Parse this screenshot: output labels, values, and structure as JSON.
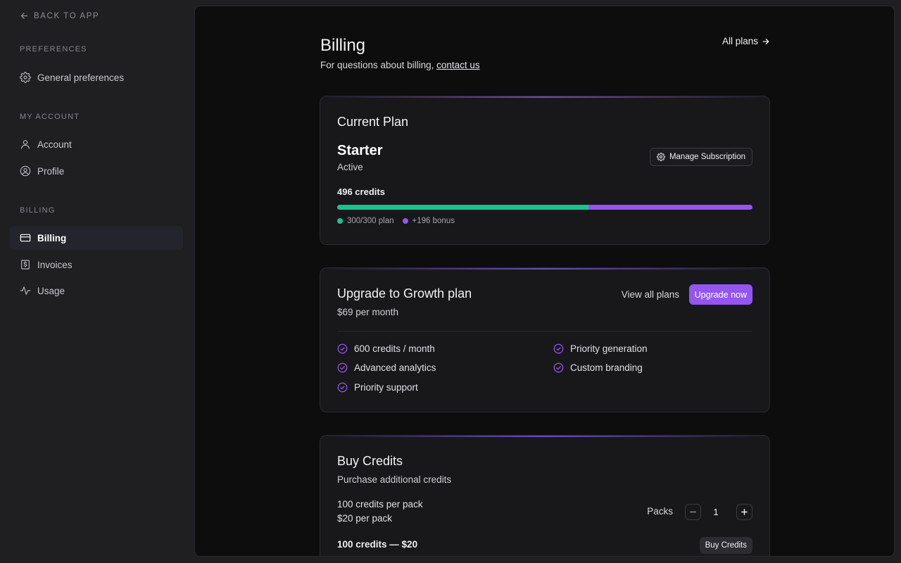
{
  "sidebar": {
    "back_label": "BACK TO APP",
    "sections": [
      {
        "label": "PREFERENCES",
        "items": [
          {
            "label": "General preferences",
            "icon": "gear-icon"
          }
        ]
      },
      {
        "label": "MY ACCOUNT",
        "items": [
          {
            "label": "Account",
            "icon": "user-icon"
          },
          {
            "label": "Profile",
            "icon": "user-circle-icon"
          }
        ]
      },
      {
        "label": "BILLING",
        "items": [
          {
            "label": "Billing",
            "icon": "credit-card-icon",
            "active": true
          },
          {
            "label": "Invoices",
            "icon": "dollar-receipt-icon"
          },
          {
            "label": "Usage",
            "icon": "activity-icon"
          }
        ]
      }
    ]
  },
  "header": {
    "title": "Billing",
    "subtitle_prefix": "For questions about billing, ",
    "contact_link": "contact us",
    "all_plans_label": "All plans"
  },
  "current_plan": {
    "title": "Current Plan",
    "plan_name": "Starter",
    "status": "Active",
    "manage_label": "Manage Subscription",
    "credits_label": "496 credits",
    "plan_credits_used": 300,
    "plan_credits_total": 300,
    "bonus_credits": 196,
    "legend_plan": "300/300 plan",
    "legend_bonus": "+196 bonus"
  },
  "upgrade": {
    "title": "Upgrade to Growth plan",
    "price": "$69 per month",
    "view_all_label": "View all plans",
    "upgrade_label": "Upgrade now",
    "features": [
      "600 credits / month",
      "Priority generation",
      "Advanced analytics",
      "Custom branding",
      "Priority support"
    ]
  },
  "buy_credits": {
    "title": "Buy Credits",
    "subtitle": "Purchase additional credits",
    "per_pack_credits": "100 credits per pack",
    "per_pack_price": "$20 per pack",
    "packs_label": "Packs",
    "packs_value": "1",
    "total_label": "100 credits — $20",
    "buy_label": "Buy Credits"
  },
  "colors": {
    "accent": "#9455f0",
    "plan_bar": "#16c58e",
    "bonus_bar": "#9455f0"
  }
}
